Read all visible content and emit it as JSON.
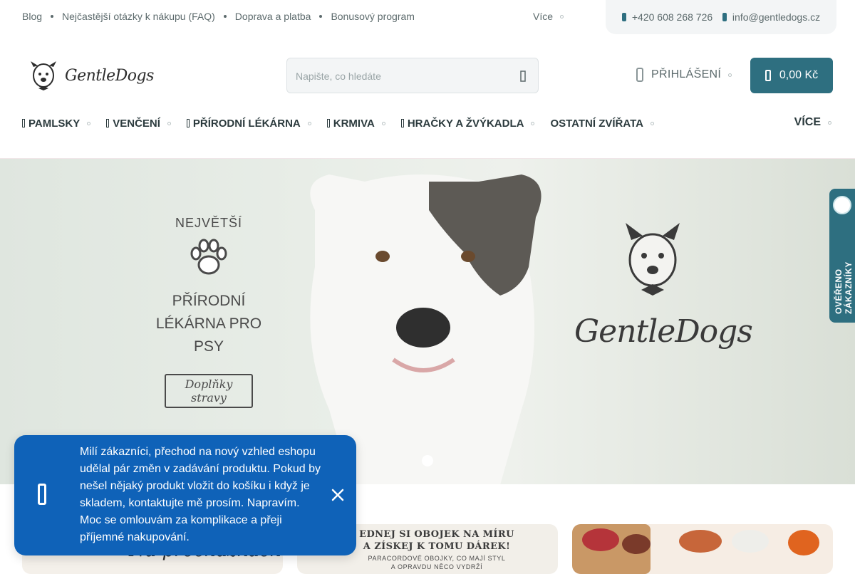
{
  "top_links": [
    "Blog",
    "Nejčastější otázky k nákupu (FAQ)",
    "Doprava a platba",
    "Bonusový program"
  ],
  "top_more": "Více",
  "contact": {
    "phone": "+420 608 268 726",
    "email": "info@gentledogs.cz"
  },
  "logo": {
    "text": "GentleDogs"
  },
  "search": {
    "placeholder": "Napište, co hledáte"
  },
  "login_label": "PŘIHLÁŠENÍ",
  "cart_total": "0,00 Kč",
  "nav": [
    "PAMLSKY",
    "VENČENÍ",
    "PŘÍRODNÍ LÉKÁRNA",
    "KRMIVA",
    "HRAČKY A ŽVÝKADLA",
    "OSTATNÍ ZVÍŘATA"
  ],
  "nav_more": "VÍCE",
  "hero": {
    "left_small": "NEJVĚTŠÍ",
    "left_line1": "PŘÍRODNÍ",
    "left_line2": "LÉKÁRNA PRO PSY",
    "left_button": "Doplňky stravy",
    "brand": "GentleDogs"
  },
  "verified_badge": "OVĚŘENO ZÁKAZNÍKY",
  "cards": {
    "card1_title": "Na procházkách",
    "card2_title": "EDNEJ SI OBOJEK NA MÍRU A ZÍSKEJ K TOMU DÁREK!",
    "card2_sub": "PARACORDOVÉ OBOJKY, CO MAJÍ STYL A OPRAVDU NĚCO VYDRŽÍ"
  },
  "notice": {
    "text": "Milí zákazníci, přechod na nový vzhled eshopu udělal pár změn v zadávání produktu. Pokud by nešel nějaký produkt vložit do košíku i když je skladem, kontaktujte mě prosím. Napravím. Moc se omlouvám za komplikace a přeji příjemné nakupování."
  },
  "colors": {
    "accent": "#2e6f80",
    "notice_bg": "#0f62b8",
    "text": "#2b3a3d"
  }
}
